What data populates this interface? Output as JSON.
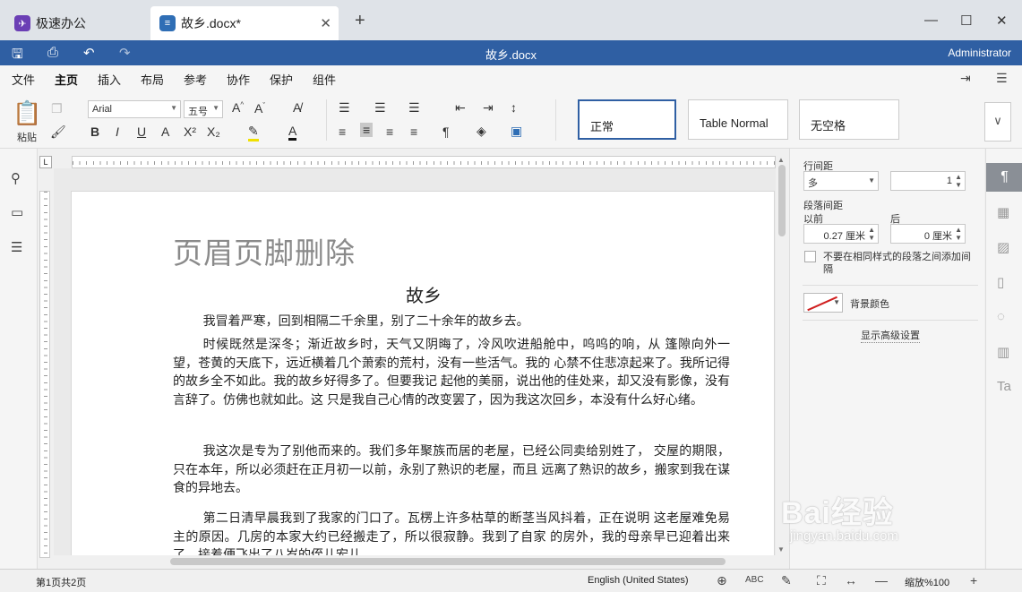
{
  "tabs": [
    {
      "label": "极速办公",
      "icon": "rocket-icon"
    },
    {
      "label": "故乡.docx*",
      "icon": "document-icon"
    }
  ],
  "titlebar": {
    "doc_title": "故乡.docx",
    "user": "Administrator"
  },
  "menu": [
    "文件",
    "主页",
    "插入",
    "布局",
    "参考",
    "协作",
    "保护",
    "组件"
  ],
  "menu_active": "主页",
  "ribbon": {
    "paste_label": "粘贴",
    "font_name": "Arial",
    "font_size": "五号",
    "styles": [
      "正常",
      "Table Normal",
      "无空格"
    ]
  },
  "document": {
    "header_text": "页眉页脚删除",
    "heading": "故乡",
    "paragraphs": [
      "我冒着严寒，回到相隔二千余里，别了二十余年的故乡去。",
      "时候既然是深冬；渐近故乡时，天气又阴晦了，冷风吹进船舱中，呜呜的响，从 篷隙向外一望，苍黄的天底下，远近横着几个萧索的荒村，没有一些活气。我的 心禁不住悲凉起来了。我所记得的故乡全不如此。我的故乡好得多了。但要我记 起他的美丽，说出他的佳处来，却又没有影像，没有言辞了。仿佛也就如此。这 只是我自己心情的改变罢了，因为我这次回乡，本没有什么好心绪。",
      "我这次是专为了别他而来的。我们多年聚族而居的老屋，已经公同卖给别姓了， 交屋的期限，只在本年，所以必须赶在正月初一以前，永别了熟识的老屋，而且 远离了熟识的故乡，搬家到我在谋食的异地去。",
      "第二日清早晨我到了我家的门口了。瓦楞上许多枯草的断茎当风抖着，正在说明 这老屋难免易主的原因。几房的本家大约已经搬走了，所以很寂静。我到了自家 的房外，我的母亲早已迎着出来了，接着便飞出了八岁的侄儿宏儿。"
    ]
  },
  "panel": {
    "line_spacing_label": "行间距",
    "line_spacing_mode": "多",
    "line_spacing_value": "1",
    "para_spacing_label": "段落间距",
    "before_label": "以前",
    "after_label": "后",
    "before_value": "0.27 厘米",
    "after_value": "0 厘米",
    "no_space_same_style": "不要在相同样式的段落之间添加间隔",
    "bg_color_label": "背景颜色",
    "advanced_link": "显示高级设置"
  },
  "status": {
    "page_info": "第1页共2页",
    "language": "English (United States)",
    "zoom": "缩放%100"
  },
  "watermark": {
    "main": "Bai经验",
    "sub": "jingyan.baidu.com"
  },
  "colors": {
    "accent": "#2f5fa3",
    "tab_bar": "#dfe3e8"
  }
}
